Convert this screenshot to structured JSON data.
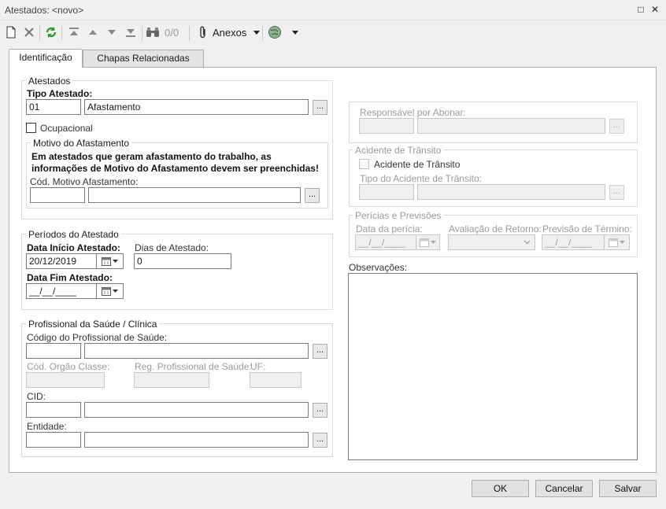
{
  "window": {
    "title": "Atestados: <novo>",
    "restore_glyph": "□",
    "close_glyph": "✕"
  },
  "toolbar": {
    "counter": "0/0",
    "attachments_label": "Anexos",
    "icons": [
      "new-icon",
      "delete-icon",
      "refresh-icon",
      "first-icon",
      "previous-icon",
      "next-icon",
      "last-icon",
      "binoculars-icon",
      "paperclip-icon",
      "globe-icon"
    ]
  },
  "tabs": [
    {
      "label": "Identificação",
      "active": true
    },
    {
      "label": "Chapas Relacionadas",
      "active": false
    }
  ],
  "atestados": {
    "legend": "Atestados",
    "tipo_label": "Tipo Atestado:",
    "tipo_code": "01",
    "tipo_desc": "Afastamento",
    "ocupacional_label": "Ocupacional",
    "motivo": {
      "legend": "Motivo do Afastamento",
      "info": "Em atestados que geram afastamento do trabalho, as informações de Motivo do Afastamento devem ser preenchidas!",
      "cod_label": "Cód. Motivo Afastamento:",
      "cod_value": "",
      "desc_value": ""
    }
  },
  "periodos": {
    "legend": "Períodos do Atestado",
    "data_inicio_label": "Data Início Atestado:",
    "data_inicio_value": "20/12/2019",
    "dias_label": "Dias de Atestado:",
    "dias_value": "0",
    "data_fim_label": "Data Fim Atestado:",
    "data_fim_value": "__/__/____"
  },
  "profissional": {
    "legend": "Profissional da Saúde / Clínica",
    "codigo_label": "Código do Profissional de Saúde:",
    "orgao_label": "Cód. Orgão Classe:",
    "registro_label": "Reg. Profissional de Saúde:",
    "uf_label": "UF:",
    "cid_label": "CID:",
    "entidade_label": "Entidade:"
  },
  "right": {
    "responsavel_label": "Responsável por Abonar:",
    "acidente": {
      "legend": "Acidente de Trânsito",
      "checkbox_label": "Acidente de Trânsito",
      "tipo_label": "Tipo do Acidente de Trânsito:"
    },
    "pericias": {
      "legend": "Perícias e Previsões",
      "data_label": "Data da perícia:",
      "data_value": "__/__/____",
      "avaliacao_label": "Avaliação de Retorno:",
      "previsao_label": "Previsão de Término:",
      "previsao_value": "__/__/____"
    },
    "observacoes_label": "Observações:"
  },
  "buttons": {
    "ok": "OK",
    "cancel": "Cancelar",
    "save": "Salvar"
  },
  "colors": {
    "refresh_green": "#2e9a2e",
    "panel_border": "#adadad",
    "disabled_text": "#9a9a9a"
  }
}
